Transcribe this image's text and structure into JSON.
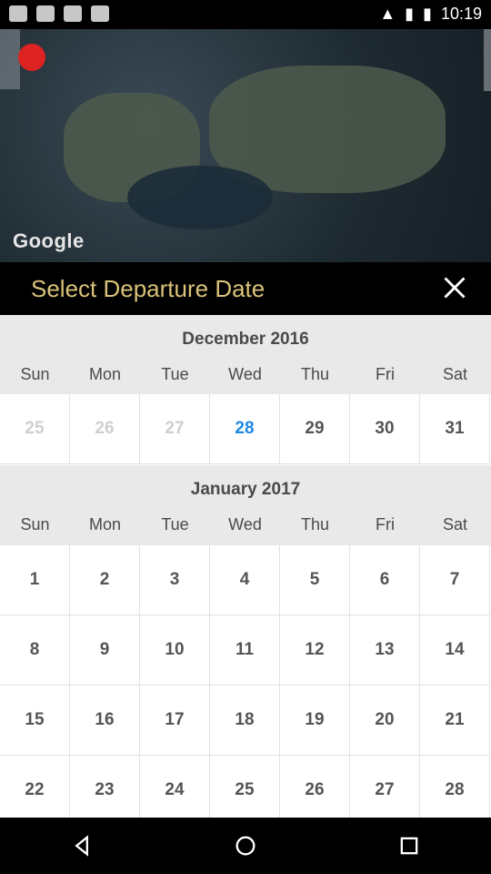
{
  "status_bar": {
    "time": "10:19"
  },
  "map": {
    "attribution": "Google"
  },
  "dialog": {
    "title": "Select Departure Date"
  },
  "weekdays": [
    "Sun",
    "Mon",
    "Tue",
    "Wed",
    "Thu",
    "Fri",
    "Sat"
  ],
  "months": [
    {
      "title": "December 2016",
      "weeks": [
        [
          {
            "label": "25",
            "state": "inactive"
          },
          {
            "label": "26",
            "state": "inactive"
          },
          {
            "label": "27",
            "state": "inactive"
          },
          {
            "label": "28",
            "state": "today"
          },
          {
            "label": "29",
            "state": "active"
          },
          {
            "label": "30",
            "state": "active"
          },
          {
            "label": "31",
            "state": "active"
          }
        ]
      ]
    },
    {
      "title": "January 2017",
      "weeks": [
        [
          {
            "label": "1",
            "state": "active"
          },
          {
            "label": "2",
            "state": "active"
          },
          {
            "label": "3",
            "state": "active"
          },
          {
            "label": "4",
            "state": "active"
          },
          {
            "label": "5",
            "state": "active"
          },
          {
            "label": "6",
            "state": "active"
          },
          {
            "label": "7",
            "state": "active"
          }
        ],
        [
          {
            "label": "8",
            "state": "active"
          },
          {
            "label": "9",
            "state": "active"
          },
          {
            "label": "10",
            "state": "active"
          },
          {
            "label": "11",
            "state": "active"
          },
          {
            "label": "12",
            "state": "active"
          },
          {
            "label": "13",
            "state": "active"
          },
          {
            "label": "14",
            "state": "active"
          }
        ],
        [
          {
            "label": "15",
            "state": "active"
          },
          {
            "label": "16",
            "state": "active"
          },
          {
            "label": "17",
            "state": "active"
          },
          {
            "label": "18",
            "state": "active"
          },
          {
            "label": "19",
            "state": "active"
          },
          {
            "label": "20",
            "state": "active"
          },
          {
            "label": "21",
            "state": "active"
          }
        ],
        [
          {
            "label": "22",
            "state": "active"
          },
          {
            "label": "23",
            "state": "active"
          },
          {
            "label": "24",
            "state": "active"
          },
          {
            "label": "25",
            "state": "active"
          },
          {
            "label": "26",
            "state": "active"
          },
          {
            "label": "27",
            "state": "active"
          },
          {
            "label": "28",
            "state": "active"
          }
        ]
      ]
    }
  ],
  "colors": {
    "title": "#d9c27a",
    "today": "#1e88e5",
    "inactive": "#cfcfcf"
  }
}
